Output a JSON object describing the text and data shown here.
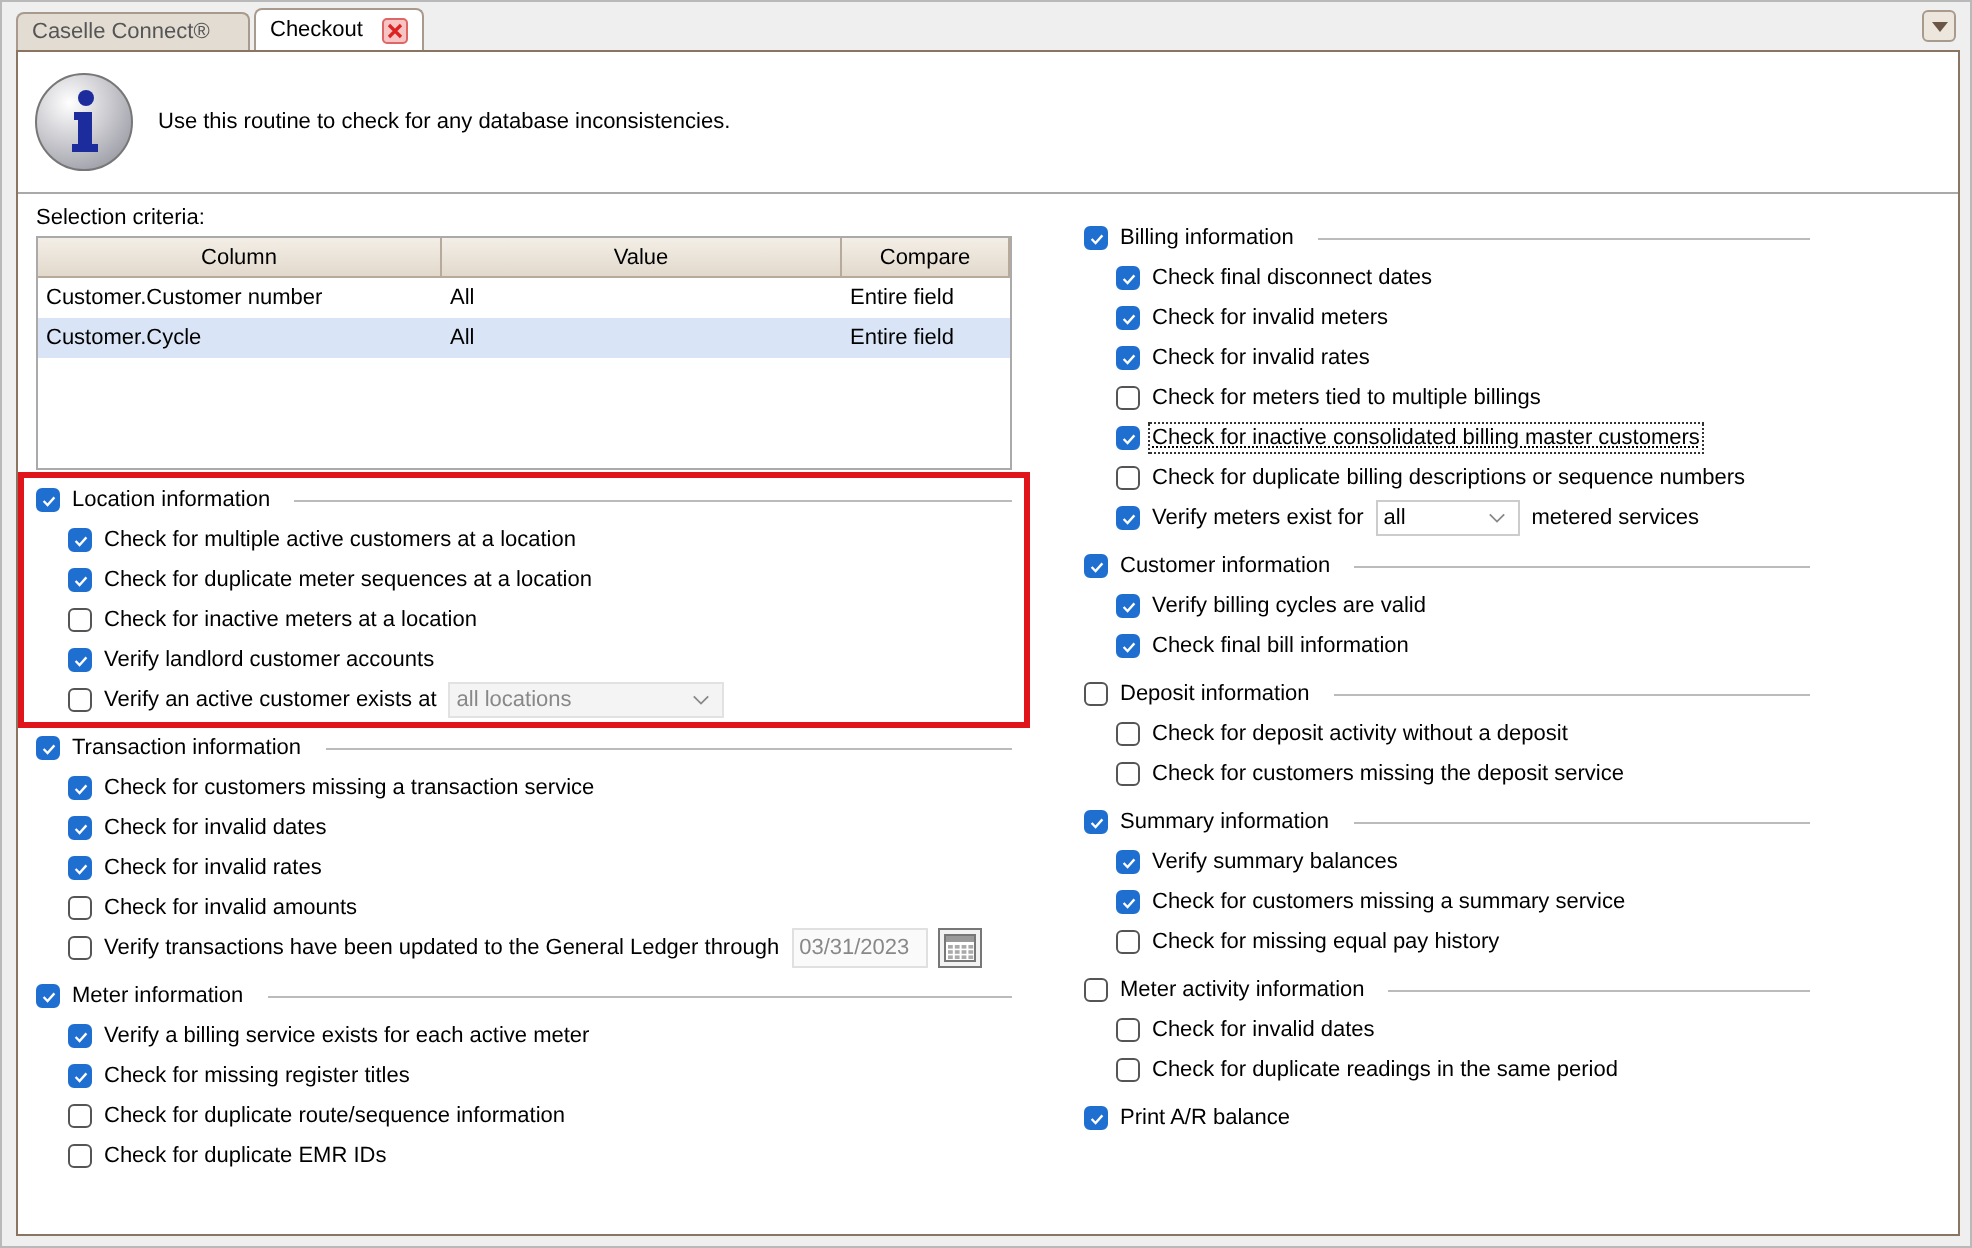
{
  "tabs": [
    {
      "label": "Caselle Connect®",
      "selected": false,
      "closable": false
    },
    {
      "label": "Checkout",
      "selected": true,
      "closable": true
    }
  ],
  "header": {
    "message": "Use this routine to check for any database inconsistencies."
  },
  "criteria": {
    "label": "Selection criteria:",
    "columns": [
      "Column",
      "Value",
      "Compare"
    ],
    "rows": [
      {
        "cells": [
          "Customer.Customer number",
          "All",
          "Entire field"
        ],
        "selected": false
      },
      {
        "cells": [
          "Customer.Cycle",
          "All",
          "Entire field"
        ],
        "selected": true
      }
    ]
  },
  "left_groups": [
    {
      "label": "Location information",
      "checked": true,
      "highlighted": true,
      "items": [
        {
          "kind": "checkbox",
          "label": "Check for multiple active customers at a location",
          "checked": true,
          "focused": false
        },
        {
          "kind": "checkbox",
          "label": "Check for duplicate meter sequences at a location",
          "checked": true,
          "focused": false
        },
        {
          "kind": "checkbox",
          "label": "Check for inactive meters at a location",
          "checked": false,
          "focused": false
        },
        {
          "kind": "checkbox",
          "label": "Verify landlord customer accounts",
          "checked": true,
          "focused": false
        },
        {
          "kind": "dropdown",
          "label": "Verify an active customer exists at",
          "checked": false,
          "focused": false,
          "value": "all locations",
          "disabled": true
        }
      ]
    },
    {
      "label": "Transaction information",
      "checked": true,
      "highlighted": false,
      "items": [
        {
          "kind": "checkbox",
          "label": "Check for customers missing a transaction service",
          "checked": true,
          "focused": false
        },
        {
          "kind": "checkbox",
          "label": "Check for invalid dates",
          "checked": true,
          "focused": false
        },
        {
          "kind": "checkbox",
          "label": "Check for invalid rates",
          "checked": true,
          "focused": false
        },
        {
          "kind": "checkbox",
          "label": "Check for invalid amounts",
          "checked": false,
          "focused": false
        },
        {
          "kind": "date",
          "label": "Verify transactions have been updated to the General Ledger through",
          "checked": false,
          "focused": false,
          "value": "03/31/2023",
          "disabled": true
        }
      ]
    },
    {
      "label": "Meter information",
      "checked": true,
      "highlighted": false,
      "items": [
        {
          "kind": "checkbox",
          "label": "Verify a billing service exists for each active meter",
          "checked": true,
          "focused": false
        },
        {
          "kind": "checkbox",
          "label": "Check for missing register titles",
          "checked": true,
          "focused": false
        },
        {
          "kind": "checkbox",
          "label": "Check for duplicate route/sequence information",
          "checked": false,
          "focused": false
        },
        {
          "kind": "checkbox",
          "label": "Check for duplicate EMR IDs",
          "checked": false,
          "focused": false
        }
      ]
    }
  ],
  "right_groups": [
    {
      "label": "Billing information",
      "checked": true,
      "highlighted": false,
      "items": [
        {
          "kind": "checkbox",
          "label": "Check final disconnect dates",
          "checked": true,
          "focused": false
        },
        {
          "kind": "checkbox",
          "label": "Check for invalid meters",
          "checked": true,
          "focused": false
        },
        {
          "kind": "checkbox",
          "label": "Check for invalid rates",
          "checked": true,
          "focused": false
        },
        {
          "kind": "checkbox",
          "label": "Check for meters tied to multiple billings",
          "checked": false,
          "focused": false
        },
        {
          "kind": "checkbox",
          "label": "Check for inactive consolidated billing master customers",
          "checked": true,
          "focused": true
        },
        {
          "kind": "checkbox",
          "label": "Check for duplicate billing descriptions or sequence numbers",
          "checked": false,
          "focused": false
        },
        {
          "kind": "dropdown",
          "label": "Verify meters exist for",
          "checked": true,
          "focused": false,
          "value": "all",
          "disabled": false,
          "suffix": "metered services"
        }
      ]
    },
    {
      "label": "Customer information",
      "checked": true,
      "highlighted": false,
      "items": [
        {
          "kind": "checkbox",
          "label": "Verify billing cycles are valid",
          "checked": true,
          "focused": false
        },
        {
          "kind": "checkbox",
          "label": "Check final bill information",
          "checked": true,
          "focused": false
        }
      ]
    },
    {
      "label": "Deposit information",
      "checked": false,
      "highlighted": false,
      "items": [
        {
          "kind": "checkbox",
          "label": "Check for deposit activity without a deposit",
          "checked": false,
          "focused": false
        },
        {
          "kind": "checkbox",
          "label": "Check for customers missing the deposit service",
          "checked": false,
          "focused": false
        }
      ]
    },
    {
      "label": "Summary information",
      "checked": true,
      "highlighted": false,
      "items": [
        {
          "kind": "checkbox",
          "label": "Verify summary balances",
          "checked": true,
          "focused": false
        },
        {
          "kind": "checkbox",
          "label": "Check for customers missing a summary service",
          "checked": true,
          "focused": false
        },
        {
          "kind": "checkbox",
          "label": "Check for missing equal pay history",
          "checked": false,
          "focused": false
        }
      ]
    },
    {
      "label": "Meter activity information",
      "checked": false,
      "highlighted": false,
      "items": [
        {
          "kind": "checkbox",
          "label": "Check for invalid dates",
          "checked": false,
          "focused": false
        },
        {
          "kind": "checkbox",
          "label": "Check for duplicate readings in the same period",
          "checked": false,
          "focused": false
        }
      ]
    },
    {
      "label": "Print A/R balance",
      "checked": true,
      "highlighted": false
    }
  ]
}
